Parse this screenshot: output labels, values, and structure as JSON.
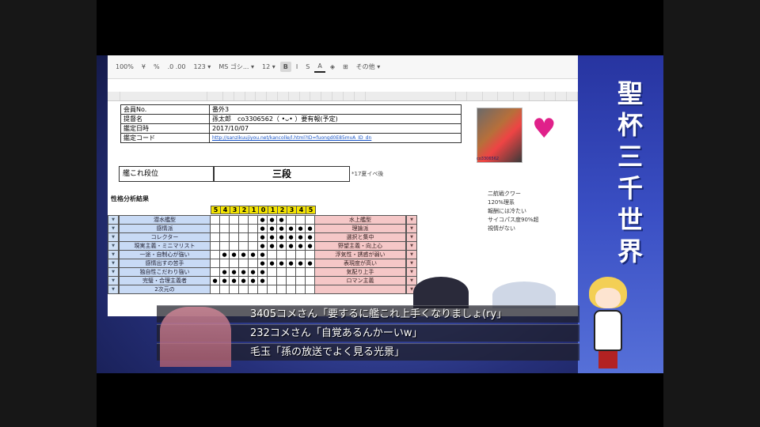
{
  "toolbar": {
    "zoom": "100%",
    "currency": "¥",
    "percent": "%",
    "decimals": ".0 .00",
    "format": "123 ▾",
    "font": "MS ゴシ... ▾",
    "size": "12 ▾",
    "bold": "B",
    "italic": "I",
    "strike": "S",
    "color": "A",
    "more": "その他 ▾"
  },
  "info": [
    {
      "key": "会員No.",
      "value": "番外3"
    },
    {
      "key": "提督名",
      "value": "孫太郎　co3306562（ •ᴗ• ）要有報(予定)"
    },
    {
      "key": "鑑定日時",
      "value": "2017/10/07"
    },
    {
      "key": "鑑定コード",
      "value": "http://sanzikuujiyou.net/kancolle/l.html?ID=fuongd0E85mvA_ID_dn"
    }
  ],
  "rank": {
    "label": "艦これ段位",
    "value": "三段",
    "note": "*17夏イベ後"
  },
  "analysis_title": "性格分析結果",
  "scale": [
    "5",
    "4",
    "3",
    "2",
    "1",
    "0",
    "1",
    "2",
    "3",
    "4",
    "5"
  ],
  "rows": [
    {
      "left": "潜水艦型",
      "marks": [
        "",
        "",
        "",
        "",
        "",
        "●",
        "●",
        "●",
        "",
        "",
        ""
      ],
      "right": "水上艦型"
    },
    {
      "left": "感情派",
      "marks": [
        "",
        "",
        "",
        "",
        "",
        "●",
        "●",
        "●",
        "●",
        "●",
        "●"
      ],
      "right": "理論派"
    },
    {
      "left": "コレクター",
      "marks": [
        "",
        "",
        "",
        "",
        "",
        "●",
        "●",
        "●",
        "●",
        "●",
        "●"
      ],
      "right": "選択と集中"
    },
    {
      "left": "現実主義・ミニマリスト",
      "marks": [
        "",
        "",
        "",
        "",
        "",
        "●",
        "●",
        "●",
        "●",
        "●",
        "●"
      ],
      "right": "野望主義・向上心"
    },
    {
      "left": "一途・自制心が強い",
      "marks": [
        "",
        "●",
        "●",
        "●",
        "●",
        "●",
        "",
        "",
        "",
        "",
        ""
      ],
      "right": "浮気性・誘惑が弱い"
    },
    {
      "left": "感情出すの苦手",
      "marks": [
        "",
        "",
        "",
        "",
        "",
        "●",
        "●",
        "●",
        "●",
        "●",
        "●"
      ],
      "right": "表現度が高い"
    },
    {
      "left": "独自性こだわり強い",
      "marks": [
        "",
        "●",
        "●",
        "●",
        "●",
        "●",
        "",
        "",
        "",
        "",
        ""
      ],
      "right": "気配り上手"
    },
    {
      "left": "完璧・合理主義者",
      "marks": [
        "●",
        "●",
        "●",
        "●",
        "●",
        "●",
        "",
        "",
        "",
        "",
        ""
      ],
      "right": "ロマン主義"
    },
    {
      "left": "2次元の",
      "marks": [
        "",
        "",
        "",
        "",
        "",
        "",
        "",
        "",
        "",
        "",
        ""
      ],
      "right": ""
    }
  ],
  "avatar_caption": "co3306562",
  "side_notes": [
    "二航戦クワー",
    "120%理系",
    "報酬には冷たい",
    "サイコパス度90%超",
    "視情がない"
  ],
  "channel_title": "聖杯三千世界",
  "comments": [
    "3405コメさん「要するに艦これ上手くなりましょ(ry」",
    "232コメさん「自覚あるんかーいw」",
    "毛玉「孫の放送でよく見る光景」"
  ],
  "colors": {
    "left_band": "#c8daf5",
    "right_band": "#f5c7c7",
    "scale": "#f4e400",
    "heart": "#e0218a"
  }
}
